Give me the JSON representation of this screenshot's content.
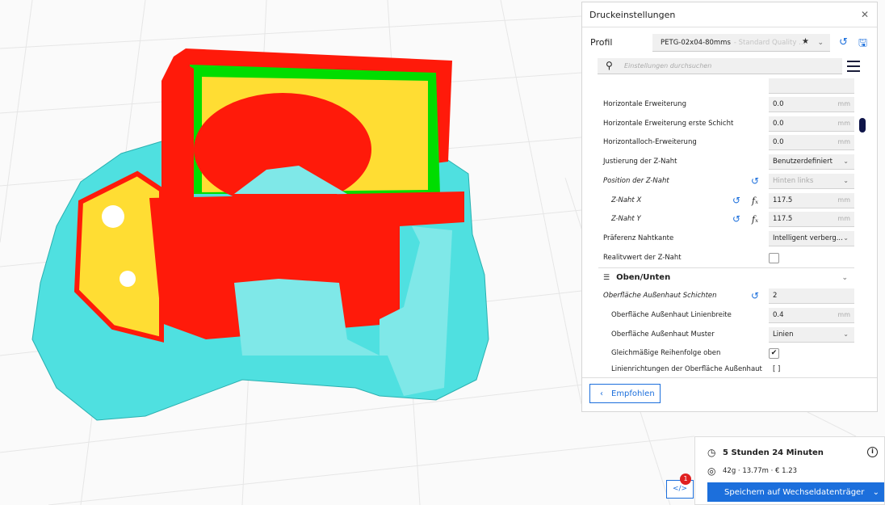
{
  "colors": {
    "accent": "#1c6fdc",
    "support": "#55e0e0",
    "wall": "#ff1a0a",
    "infill": "#00dd00",
    "skin": "#e0dd30"
  },
  "panel": {
    "title": "Druckeinstellungen",
    "close_icon": "close-icon",
    "profile_label": "Profil",
    "profile_name": "PETG-02x04-80mms",
    "profile_sub": "- Standard Quality - 0...",
    "search_placeholder": "Einstellungen durchsuchen",
    "settings": [
      {
        "label": "Horizontale Erweiterung",
        "value": "0.0",
        "unit": "mm"
      },
      {
        "label": "Horizontale Erweiterung erste Schicht",
        "value": "0.0",
        "unit": "mm"
      },
      {
        "label": "Horizontalloch-Erweiterung",
        "value": "0.0",
        "unit": "mm"
      },
      {
        "label": "Justierung der Z-Naht",
        "value": "Benutzerdefiniert"
      },
      {
        "label": "Position der Z-Naht",
        "value": "Hinten links"
      },
      {
        "label": "Z-Naht X",
        "value": "117.5",
        "unit": "mm"
      },
      {
        "label": "Z-Naht Y",
        "value": "117.5",
        "unit": "mm"
      },
      {
        "label": "Präferenz Nahtkante",
        "value": "Intelligent verberg..."
      },
      {
        "label": "Realitvwert der Z-Naht",
        "checked": false
      },
      {
        "label": "Oberfläche Außenhaut Schichten",
        "value": "2"
      },
      {
        "label": "Oberfläche Außenhaut Linienbreite",
        "value": "0.4",
        "unit": "mm"
      },
      {
        "label": "Oberfläche Außenhaut Muster",
        "value": "Linien"
      },
      {
        "label": "Gleichmäßige Reihenfolge oben",
        "checked": true
      },
      {
        "label": "Linienrichtungen der Oberfläche Außenhaut",
        "value": "[ ]"
      }
    ],
    "section_title": "Oben/Unten",
    "recommended_label": "Empfohlen"
  },
  "summary": {
    "time": "5 Stunden 24 Minuten",
    "material": "42g · 13.77m · € 1.23",
    "save_label": "Speichern auf Wechseldatenträger",
    "badge": "1"
  }
}
